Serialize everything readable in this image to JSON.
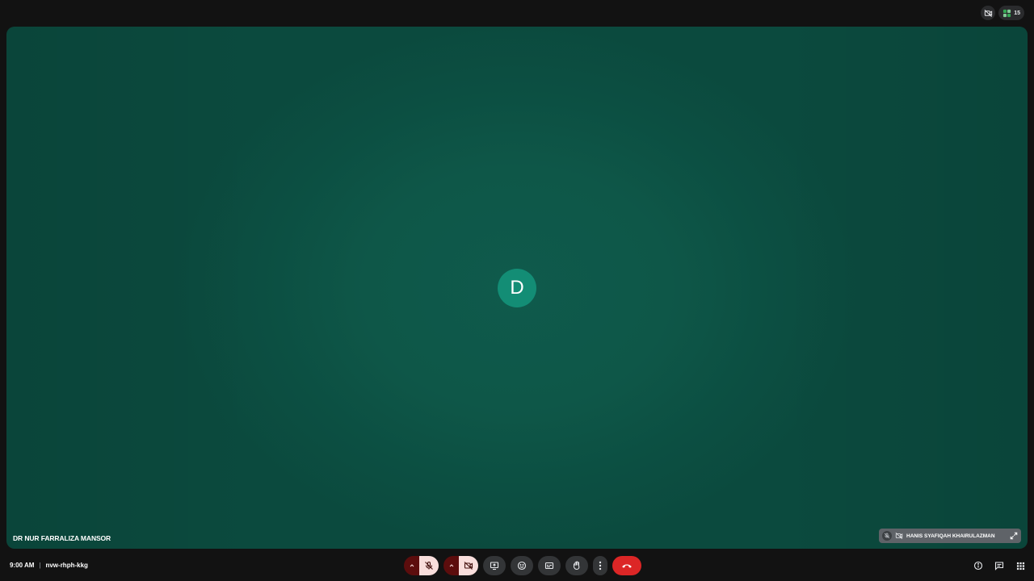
{
  "top_bar": {
    "icons": [
      {
        "name": "camera-off-icon"
      },
      {
        "name": "people-grid-icon",
        "count": "15"
      }
    ]
  },
  "stage": {
    "participant_initial": "D",
    "participant_name": "DR NUR FARRALIZA MANSOR",
    "background_color": "#0e5748",
    "avatar_color": "#138d75"
  },
  "self_view": {
    "name": "HANIS SYAFIQAH KHAIRULAZMAN",
    "icons": [
      "mic-off-icon",
      "camera-off-icon",
      "expand-icon"
    ]
  },
  "meeting": {
    "time": "9:00 AM",
    "separator": "|",
    "code": "nvw-rhph-kkg"
  },
  "controls": [
    {
      "name": "mic-options-caret",
      "icon": "chevron-up-icon"
    },
    {
      "name": "mic-toggle-button",
      "icon": "mic-off-icon",
      "state": "off"
    },
    {
      "name": "camera-options-caret",
      "icon": "chevron-up-icon"
    },
    {
      "name": "camera-toggle-button",
      "icon": "camera-off-icon",
      "state": "off"
    },
    {
      "name": "present-button",
      "icon": "present-screen-icon"
    },
    {
      "name": "reactions-button",
      "icon": "smiley-icon"
    },
    {
      "name": "captions-button",
      "icon": "captions-icon"
    },
    {
      "name": "raise-hand-button",
      "icon": "hand-icon"
    },
    {
      "name": "more-options-button",
      "icon": "more-vert-icon"
    },
    {
      "name": "leave-call-button",
      "icon": "call-end-icon",
      "color": "#dc2626"
    }
  ],
  "right_controls": [
    {
      "name": "meeting-details-button",
      "icon": "info-icon"
    },
    {
      "name": "chat-button",
      "icon": "chat-icon"
    },
    {
      "name": "activities-button",
      "icon": "apps-grid-icon"
    }
  ],
  "colors": {
    "mute_active": "#f9dedc",
    "mute_caret": "#5c0d0d",
    "control_bg": "#333537",
    "end_call": "#dc2626"
  }
}
